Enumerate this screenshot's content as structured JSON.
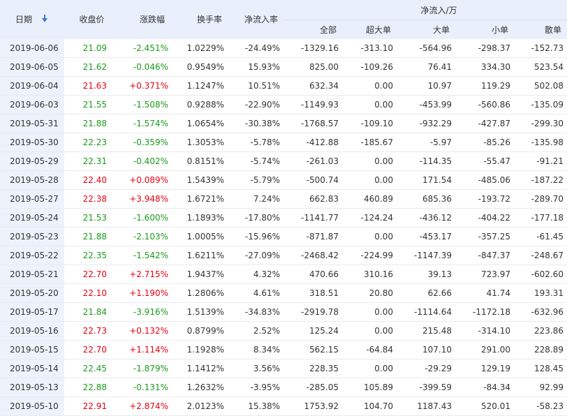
{
  "headers": {
    "date": "日期",
    "close": "收盘价",
    "change": "涨跌幅",
    "turnover": "换手率",
    "net_rate": "净流入率",
    "net_flow_group": "净流入/万",
    "total": "全部",
    "super_large": "超大单",
    "large": "大单",
    "small": "小单",
    "retail": "散单"
  },
  "colors": {
    "up": "#e60012",
    "down": "#1a9b1a",
    "header_bg": "#e9f0fb",
    "date_bg": "#edf3fc"
  },
  "rows": [
    {
      "date": "2019-06-06",
      "close": "21.09",
      "change": "-2.451%",
      "turnover": "1.0229%",
      "net_rate": "-24.49%",
      "total": "-1329.16",
      "super": "-313.10",
      "large": "-564.96",
      "small": "-298.37",
      "retail": "-152.73",
      "dir": "down"
    },
    {
      "date": "2019-06-05",
      "close": "21.62",
      "change": "-0.046%",
      "turnover": "0.9549%",
      "net_rate": "15.93%",
      "total": "825.00",
      "super": "-109.26",
      "large": "76.41",
      "small": "334.30",
      "retail": "523.54",
      "dir": "down"
    },
    {
      "date": "2019-06-04",
      "close": "21.63",
      "change": "+0.371%",
      "turnover": "1.1247%",
      "net_rate": "10.51%",
      "total": "632.34",
      "super": "0.00",
      "large": "10.97",
      "small": "119.29",
      "retail": "502.08",
      "dir": "up"
    },
    {
      "date": "2019-06-03",
      "close": "21.55",
      "change": "-1.508%",
      "turnover": "0.9288%",
      "net_rate": "-22.90%",
      "total": "-1149.93",
      "super": "0.00",
      "large": "-453.99",
      "small": "-560.86",
      "retail": "-135.09",
      "dir": "down"
    },
    {
      "date": "2019-05-31",
      "close": "21.88",
      "change": "-1.574%",
      "turnover": "1.0654%",
      "net_rate": "-30.38%",
      "total": "-1768.57",
      "super": "-109.10",
      "large": "-932.29",
      "small": "-427.87",
      "retail": "-299.30",
      "dir": "down"
    },
    {
      "date": "2019-05-30",
      "close": "22.23",
      "change": "-0.359%",
      "turnover": "1.3053%",
      "net_rate": "-5.78%",
      "total": "-412.88",
      "super": "-185.67",
      "large": "-5.97",
      "small": "-85.26",
      "retail": "-135.98",
      "dir": "down"
    },
    {
      "date": "2019-05-29",
      "close": "22.31",
      "change": "-0.402%",
      "turnover": "0.8151%",
      "net_rate": "-5.74%",
      "total": "-261.03",
      "super": "0.00",
      "large": "-114.35",
      "small": "-55.47",
      "retail": "-91.21",
      "dir": "down"
    },
    {
      "date": "2019-05-28",
      "close": "22.40",
      "change": "+0.089%",
      "turnover": "1.5439%",
      "net_rate": "-5.79%",
      "total": "-500.74",
      "super": "0.00",
      "large": "171.54",
      "small": "-485.06",
      "retail": "-187.22",
      "dir": "up"
    },
    {
      "date": "2019-05-27",
      "close": "22.38",
      "change": "+3.948%",
      "turnover": "1.6721%",
      "net_rate": "7.24%",
      "total": "662.83",
      "super": "460.89",
      "large": "685.36",
      "small": "-193.72",
      "retail": "-289.70",
      "dir": "up"
    },
    {
      "date": "2019-05-24",
      "close": "21.53",
      "change": "-1.600%",
      "turnover": "1.1893%",
      "net_rate": "-17.80%",
      "total": "-1141.77",
      "super": "-124.24",
      "large": "-436.12",
      "small": "-404.22",
      "retail": "-177.18",
      "dir": "down"
    },
    {
      "date": "2019-05-23",
      "close": "21.88",
      "change": "-2.103%",
      "turnover": "1.0005%",
      "net_rate": "-15.96%",
      "total": "-871.87",
      "super": "0.00",
      "large": "-453.17",
      "small": "-357.25",
      "retail": "-61.45",
      "dir": "down"
    },
    {
      "date": "2019-05-22",
      "close": "22.35",
      "change": "-1.542%",
      "turnover": "1.6211%",
      "net_rate": "-27.09%",
      "total": "-2468.42",
      "super": "-224.99",
      "large": "-1147.39",
      "small": "-847.37",
      "retail": "-248.67",
      "dir": "down"
    },
    {
      "date": "2019-05-21",
      "close": "22.70",
      "change": "+2.715%",
      "turnover": "1.9437%",
      "net_rate": "4.32%",
      "total": "470.66",
      "super": "310.16",
      "large": "39.13",
      "small": "723.97",
      "retail": "-602.60",
      "dir": "up"
    },
    {
      "date": "2019-05-20",
      "close": "22.10",
      "change": "+1.190%",
      "turnover": "1.2806%",
      "net_rate": "4.61%",
      "total": "318.51",
      "super": "20.80",
      "large": "62.66",
      "small": "41.74",
      "retail": "193.31",
      "dir": "up"
    },
    {
      "date": "2019-05-17",
      "close": "21.84",
      "change": "-3.916%",
      "turnover": "1.5139%",
      "net_rate": "-34.83%",
      "total": "-2919.78",
      "super": "0.00",
      "large": "-1114.64",
      "small": "-1172.18",
      "retail": "-632.96",
      "dir": "down"
    },
    {
      "date": "2019-05-16",
      "close": "22.73",
      "change": "+0.132%",
      "turnover": "0.8799%",
      "net_rate": "2.52%",
      "total": "125.24",
      "super": "0.00",
      "large": "215.48",
      "small": "-314.10",
      "retail": "223.86",
      "dir": "up"
    },
    {
      "date": "2019-05-15",
      "close": "22.70",
      "change": "+1.114%",
      "turnover": "1.1928%",
      "net_rate": "8.34%",
      "total": "562.15",
      "super": "-64.84",
      "large": "107.10",
      "small": "291.00",
      "retail": "228.89",
      "dir": "up"
    },
    {
      "date": "2019-05-14",
      "close": "22.45",
      "change": "-1.879%",
      "turnover": "1.1412%",
      "net_rate": "3.56%",
      "total": "228.35",
      "super": "0.00",
      "large": "-29.29",
      "small": "129.19",
      "retail": "128.45",
      "dir": "down"
    },
    {
      "date": "2019-05-13",
      "close": "22.88",
      "change": "-0.131%",
      "turnover": "1.2632%",
      "net_rate": "-3.95%",
      "total": "-285.05",
      "super": "105.89",
      "large": "-399.59",
      "small": "-84.34",
      "retail": "92.99",
      "dir": "down"
    },
    {
      "date": "2019-05-10",
      "close": "22.91",
      "change": "+2.874%",
      "turnover": "2.0123%",
      "net_rate": "15.38%",
      "total": "1753.92",
      "super": "104.70",
      "large": "1187.43",
      "small": "520.01",
      "retail": "-58.23",
      "dir": "up"
    }
  ]
}
